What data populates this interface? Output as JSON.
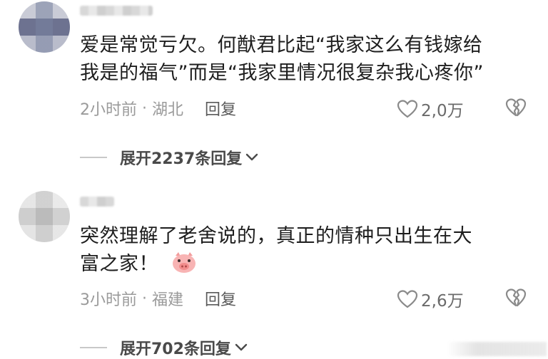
{
  "comments": [
    {
      "text_lines": [
        "爱是常觉亏欠。何猷君比起“我家这么有钱嫁给",
        "我是的福气”而是“我家里情况很复杂我心疼你”"
      ],
      "time": "2小时前",
      "location": "湖北",
      "reply_label": "回复",
      "likes": "2,0万",
      "expand_label": "展开2237条回复"
    },
    {
      "text_lines": [
        "突然理解了老舍说的，真正的情种只出生在大",
        "富之家！"
      ],
      "time": "3小时前",
      "location": "福建",
      "reply_label": "回复",
      "likes": "2,6万",
      "expand_label": "展开702条回复"
    }
  ],
  "icons": {
    "like": "heart-outline-icon",
    "dislike": "broken-heart-icon",
    "expand": "chevron-down-icon",
    "emoji": "pig-face-emoji"
  },
  "colors": {
    "text": "#1e1e1e",
    "meta": "#9a9a9a",
    "pig": "#f6a9a9"
  }
}
